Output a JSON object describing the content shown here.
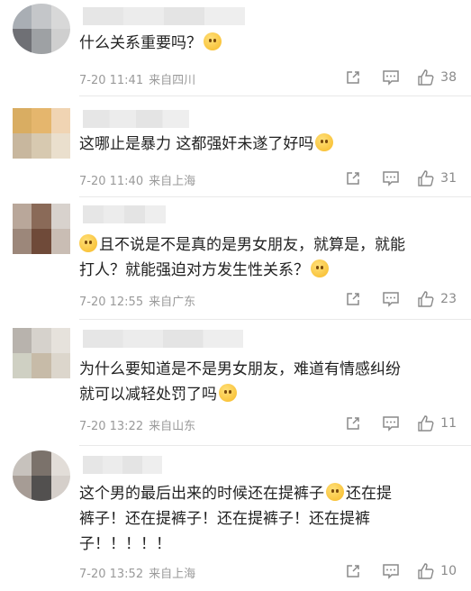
{
  "comments": [
    {
      "text_lines": [
        "什么关系重要吗？"
      ],
      "emoji_end": true,
      "time": "7-20 11:41",
      "location": "来自四川",
      "likes": "38"
    },
    {
      "text_lines": [
        "这哪止是暴力 这都强奸未遂了好吗"
      ],
      "emoji_end": true,
      "time": "7-20 11:40",
      "location": "来自上海",
      "likes": "31"
    },
    {
      "text_lines": [
        "且不说是不是真的是男女朋友，就算是，就能",
        "打人？就能强迫对方发生性关系？"
      ],
      "emoji_start": true,
      "emoji_end": true,
      "time": "7-20 12:55",
      "location": "来自广东",
      "likes": "23"
    },
    {
      "text_lines": [
        "为什么要知道是不是男女朋友，难道有情感纠纷",
        "就可以减轻处罚了吗"
      ],
      "emoji_end": true,
      "time": "7-20 13:22",
      "location": "来自山东",
      "likes": "11"
    },
    {
      "text_lines": [
        "这个男的最后出来的时候还在提裤子",
        "还在提",
        "裤子！还在提裤子！还在提裤子！还在提裤",
        "子！！！！！"
      ],
      "time": "7-20 13:52",
      "location": "来自上海",
      "likes": "10"
    }
  ],
  "colors": {
    "text": "#222222",
    "meta": "#9a9a9a",
    "icon": "#8a8a8a"
  },
  "icons": [
    "share-icon",
    "comment-icon",
    "thumbs-up-icon"
  ]
}
